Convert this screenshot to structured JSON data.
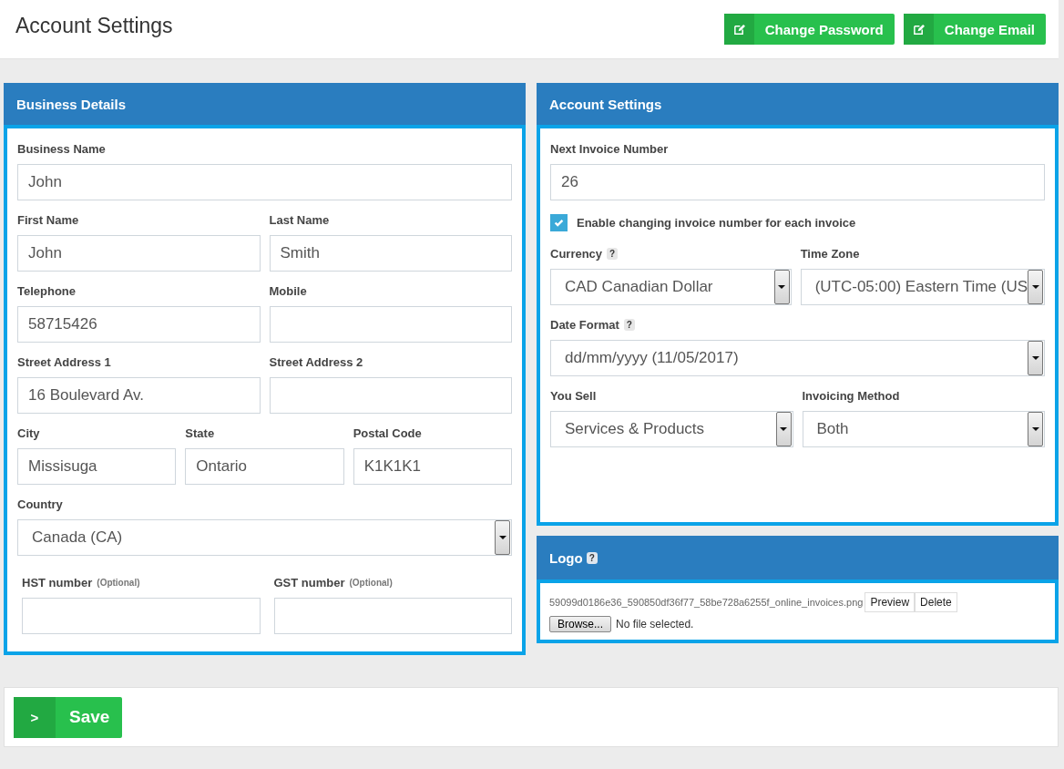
{
  "header": {
    "title": "Account Settings",
    "buttons": [
      {
        "label": "Change Password"
      },
      {
        "label": "Change Email"
      }
    ]
  },
  "business_details": {
    "title": "Business Details",
    "rows": [
      [
        {
          "label": "Business Name",
          "value": "John",
          "kind": "text"
        }
      ],
      [
        {
          "label": "First Name",
          "value": "John",
          "kind": "text"
        },
        {
          "label": "Last Name",
          "value": "Smith",
          "kind": "text"
        }
      ],
      [
        {
          "label": "Telephone",
          "value": "58715426",
          "kind": "text"
        },
        {
          "label": "Mobile",
          "kind": "text"
        }
      ],
      [
        {
          "label": "Street Address 1",
          "value": "16 Boulevard Av.",
          "kind": "text"
        },
        {
          "label": "Street Address 2",
          "kind": "text"
        }
      ],
      [
        {
          "label": "City",
          "value": "Missisuga",
          "kind": "text"
        },
        {
          "label": "State",
          "value": "Ontario",
          "kind": "text"
        },
        {
          "label": "Postal Code",
          "value": "K1K1K1",
          "kind": "text"
        }
      ],
      [
        {
          "label": "Country",
          "value": "Canada (CA)",
          "kind": "select"
        }
      ],
      [
        {
          "label": "HST number",
          "hint": "(Optional)",
          "kind": "text"
        },
        {
          "label": "GST number",
          "hint": "(Optional)",
          "kind": "text"
        }
      ]
    ]
  },
  "account_settings": {
    "title": "Account Settings",
    "rows": [
      [
        {
          "label": "Next Invoice Number",
          "value": "26",
          "kind": "text"
        }
      ],
      [
        {
          "label": "Enable changing invoice number for each invoice",
          "checked": true,
          "kind": "checkbox"
        }
      ],
      [
        {
          "label": "Currency",
          "help": "?",
          "value": "CAD Canadian Dollar",
          "kind": "select"
        },
        {
          "label": "Time Zone",
          "value": "(UTC-05:00) Eastern Time (US",
          "kind": "select"
        }
      ],
      [
        {
          "label": "Date Format",
          "help": "?",
          "value": "dd/mm/yyyy (11/05/2017)",
          "kind": "select"
        }
      ],
      [
        {
          "label": "You Sell",
          "value": "Services & Products",
          "kind": "select"
        },
        {
          "label": "Invoicing Method",
          "value": "Both",
          "kind": "select"
        }
      ]
    ]
  },
  "logo": {
    "title": "Logo",
    "help": "?",
    "file_name": "59099d0186e36_590850df36f77_58be728a6255f_online_invoices.png",
    "buttons": [
      {
        "label": "Preview"
      },
      {
        "label": "Delete"
      }
    ],
    "browse": {
      "label": "Browse...",
      "status": "No file selected."
    }
  },
  "save_button": {
    "label": "Save",
    "icon": ">"
  }
}
